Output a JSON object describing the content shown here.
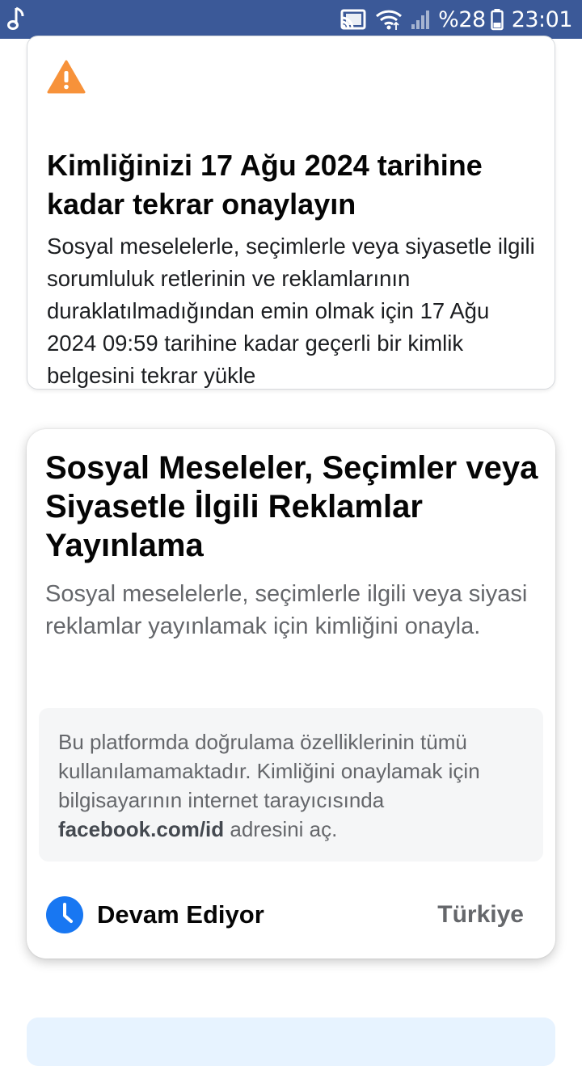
{
  "status_bar": {
    "music_icon": "music-note-icon",
    "cast_icon": "cast-icon",
    "wifi_icon": "wifi-icon",
    "signal_icon": "signal-icon",
    "battery_percent": "%28",
    "battery_icon": "battery-icon",
    "time": "23:01"
  },
  "warning_card": {
    "icon": "warning-icon",
    "title": "Kimliğinizi 17 Ağu 2024 tarihine kadar tekrar onaylayın",
    "body": "Sosyal meselelerle, seçimlerle veya siyasetle ilgili sorumluluk retlerinin ve reklamlarının duraklatılmadığından emin olmak için 17 Ağu 2024 09:59 tarihine kadar geçerli bir kimlik belgesini tekrar yükle"
  },
  "ads_card": {
    "title": "Sosyal Meseleler, Seçimler veya Siyasetle İlgili Reklamlar Yayınlama",
    "description": "Sosyal meselelerle, seçimlerle ilgili veya siyasi reklamlar yayınlamak için kimliğini onayla.",
    "info_text_before": "Bu platformda doğrulama özelliklerinin tümü kullanılamamaktadır. Kimliğini onaylamak için bilgisayarının internet tarayıcısında ",
    "info_link": "facebook.com/id",
    "info_text_after": " adresini aç.",
    "status_icon": "clock-icon",
    "status": "Devam Ediyor",
    "country": "Türkiye"
  },
  "colors": {
    "status_bar_bg": "#3b5998",
    "warning_orange": "#f7923a",
    "clock_blue": "#1877f2",
    "secondary_text": "#65676b",
    "info_box_bg": "#f5f6f7"
  }
}
